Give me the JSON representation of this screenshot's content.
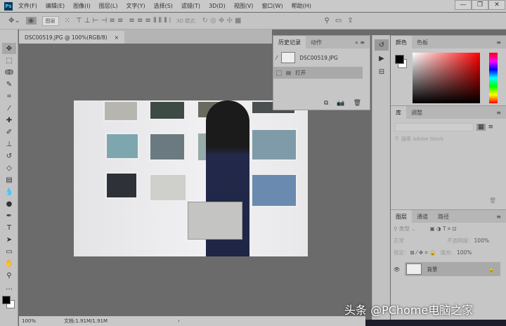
{
  "app": {
    "logo": "Ps"
  },
  "menu": [
    "文件(F)",
    "编辑(E)",
    "图像(I)",
    "图层(L)",
    "文字(Y)",
    "选择(S)",
    "滤镜(T)",
    "3D(D)",
    "视图(V)",
    "窗口(W)",
    "帮助(H)"
  ],
  "window_controls": {
    "minimize": "—",
    "restore": "❐",
    "close": "✕"
  },
  "options": {
    "auto_select": "图层",
    "mode_3d": "3D 模式:"
  },
  "document": {
    "tab": "DSC00519.JPG @ 100%(RGB/8)",
    "close": "×",
    "zoom": "100%",
    "doc_size": "文档:1.91M/1.91M",
    "arrow": "›"
  },
  "history": {
    "tabs": [
      "历史记录",
      "动作"
    ],
    "snapshot": "DSC00519.JPG",
    "items": [
      "打开"
    ]
  },
  "color_panel": {
    "tabs": [
      "颜色",
      "色板"
    ],
    "foreground": "#000000",
    "background": "#ffffff"
  },
  "library_panel": {
    "tabs": [
      "库",
      "调整"
    ],
    "search_placeholder": "搜索 Adobe Stock"
  },
  "layers_panel": {
    "tabs": [
      "图层",
      "通道",
      "路径"
    ],
    "filter": "类型",
    "blend": "正常",
    "opacity_label": "不透明度:",
    "opacity": "100%",
    "lock_label": "锁定:",
    "fill_label": "填充:",
    "fill": "100%",
    "layers": [
      {
        "name": "背景",
        "visible": true,
        "locked": true
      }
    ]
  },
  "watermark": "头条 @PChome电脑之家"
}
